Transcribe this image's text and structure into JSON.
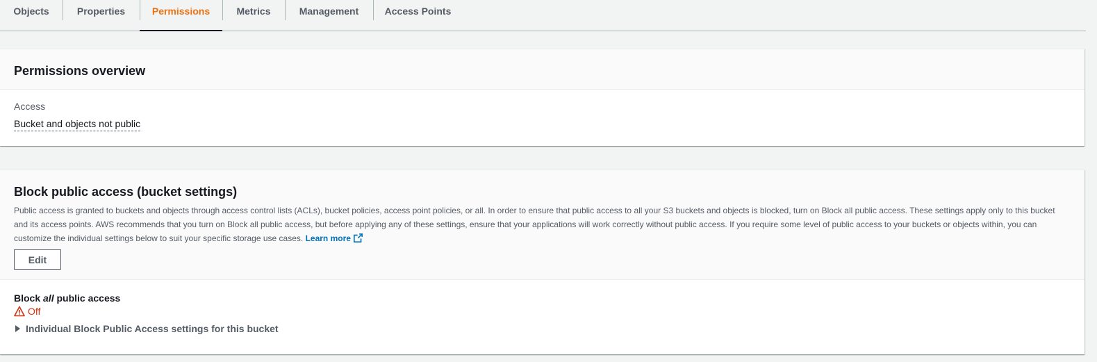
{
  "tabs": [
    {
      "label": "Objects",
      "active": false
    },
    {
      "label": "Properties",
      "active": false
    },
    {
      "label": "Permissions",
      "active": true
    },
    {
      "label": "Metrics",
      "active": false
    },
    {
      "label": "Management",
      "active": false
    },
    {
      "label": "Access Points",
      "active": false
    }
  ],
  "overview": {
    "title": "Permissions overview",
    "access_label": "Access",
    "access_value": "Bucket and objects not public"
  },
  "block_public": {
    "title": "Block public access (bucket settings)",
    "description": "Public access is granted to buckets and objects through access control lists (ACLs), bucket policies, access point policies, or all. In order to ensure that public access to all your S3 buckets and objects is blocked, turn on Block all public access. These settings apply only to this bucket and its access points. AWS recommends that you turn on Block all public access, but before applying any of these settings, ensure that your applications will work correctly without public access. If you require some level of public access to your buckets or objects within, you can customize the individual settings below to suit your specific storage use cases.",
    "learn_more": "Learn more",
    "edit_label": "Edit",
    "setting_prefix": "Block ",
    "setting_emphasis": "all",
    "setting_suffix": " public access",
    "status": "Off",
    "expander_label": "Individual Block Public Access settings for this bucket"
  },
  "colors": {
    "accent": "#ec7211",
    "link": "#0073bb",
    "error": "#d13212"
  },
  "icons": [
    "external-link-icon",
    "warning-icon",
    "caret-right-icon"
  ]
}
